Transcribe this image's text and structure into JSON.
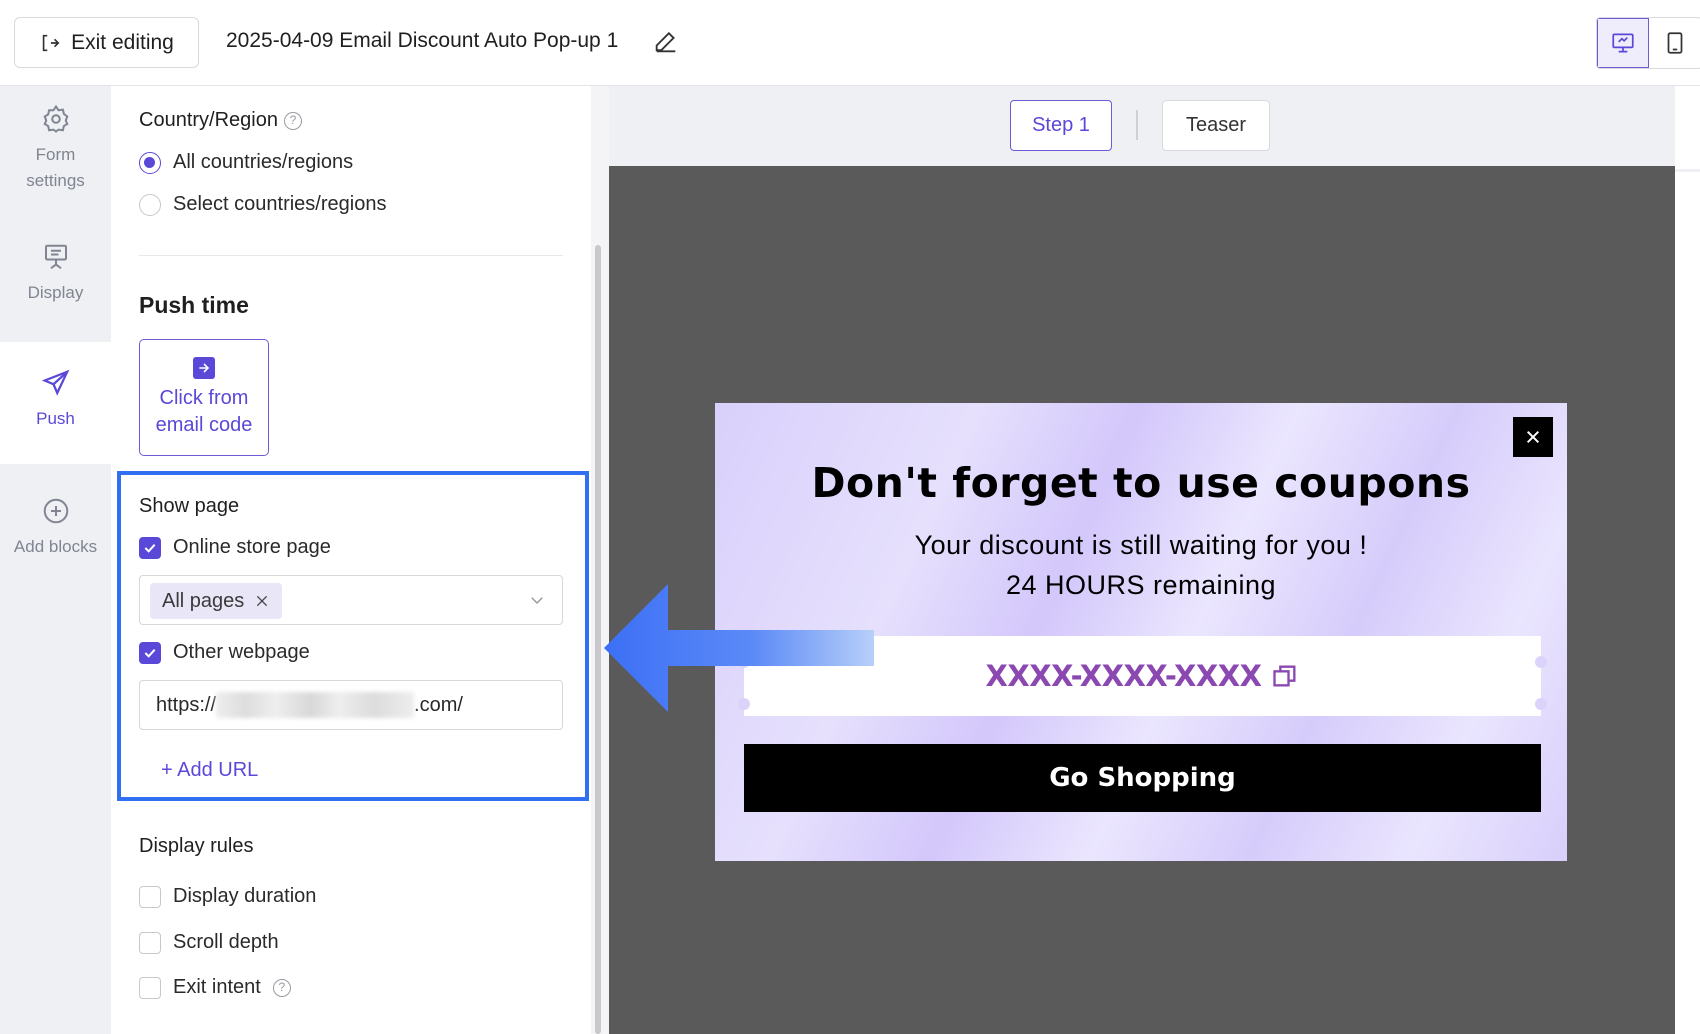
{
  "header": {
    "exit_label": "Exit editing",
    "doc_title": "2025-04-09 Email Discount Auto Pop-up 1"
  },
  "leftnav": {
    "items": [
      {
        "label": "Form settings",
        "icon": "gear-icon"
      },
      {
        "label": "Display",
        "icon": "display-icon"
      },
      {
        "label": "Push",
        "icon": "send-icon"
      },
      {
        "label": "Add blocks",
        "icon": "plus-circle-icon"
      }
    ],
    "active": "Push"
  },
  "panel": {
    "country_label": "Country/Region",
    "country_options": [
      "All countries/regions",
      "Select countries/regions"
    ],
    "country_selected": "All countries/regions",
    "push_time_title": "Push time",
    "push_card_label": "Click from email code",
    "show_page_label": "Show page",
    "online_store_label": "Online store page",
    "online_store_checked": true,
    "pages_tag": "All pages",
    "other_webpage_label": "Other webpage",
    "other_webpage_checked": true,
    "url_prefix": "https://",
    "url_suffix": ".com/",
    "add_url_label": "+ Add URL",
    "display_rules_label": "Display rules",
    "rules": [
      {
        "label": "Display duration",
        "checked": false
      },
      {
        "label": "Scroll depth",
        "checked": false
      },
      {
        "label": "Exit intent",
        "checked": false
      }
    ]
  },
  "canvas": {
    "steps": [
      "Step 1",
      "Teaser"
    ],
    "active_step": "Step 1"
  },
  "popup": {
    "title": "Don't forget to use coupons",
    "subtitle_1": "Your discount is still waiting for you !",
    "subtitle_2": "24 HOURS remaining",
    "coupon_code": "XXXX-XXXX-XXXX",
    "cta_label": "Go Shopping"
  },
  "colors": {
    "accent": "#5a48d8",
    "highlight": "#2f6ff0",
    "coupon_text": "#8a48b0",
    "canvas_bg": "#5a5a5a"
  }
}
